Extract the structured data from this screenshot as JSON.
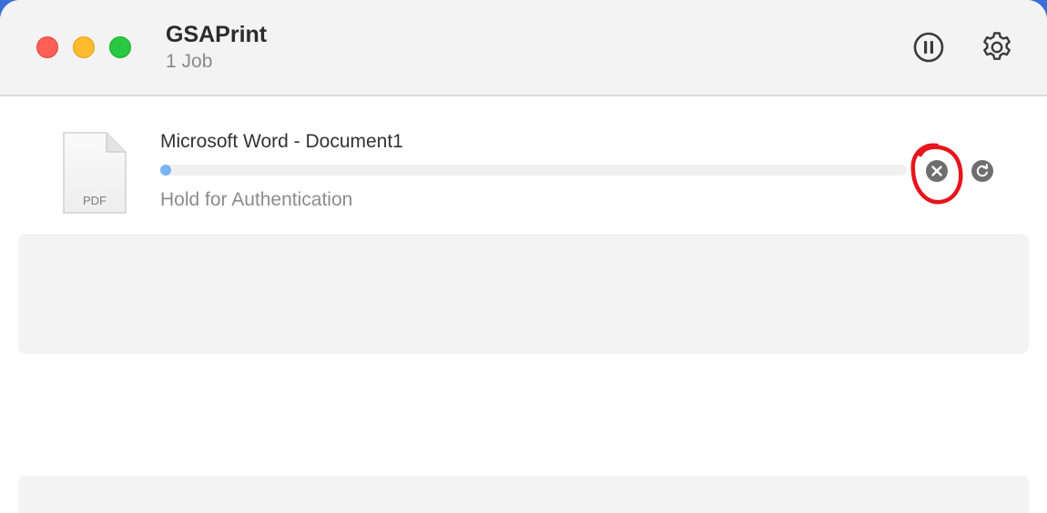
{
  "window": {
    "title": "GSAPrint",
    "subtitle": "1 Job",
    "traffic_lights": {
      "close_color": "#fe5f57",
      "minimize_color": "#febc2e",
      "maximize_color": "#28c840"
    },
    "toolbar": {
      "pause_icon": "pause-circle-icon",
      "settings_icon": "gear-icon"
    }
  },
  "job": {
    "document_icon": "pdf-document-icon",
    "file_type_label": "PDF",
    "title": "Microsoft Word - Document1",
    "status": "Hold for Authentication",
    "progress_fraction": 0.0,
    "progress_color": "#79b3f5",
    "cancel_icon": "close-circle-icon",
    "resume_icon": "refresh-circle-icon",
    "annotation_color": "#e8141c"
  }
}
